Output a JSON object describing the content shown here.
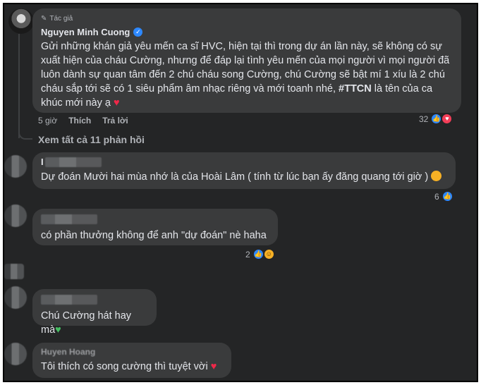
{
  "thread": {
    "author_badge": "Tác giả",
    "author_name": "Nguyen Minh Cuong",
    "body_before": "Gửi những khán giả yêu mến ca sĩ HVC, hiện tại thì trong dự án lần này, sẽ không có sự xuất hiện của cháu Cường, nhưng để đáp lại tình yêu mến của mọi người vì mọi người đã luôn dành sự quan tâm đến 2 chú cháu song Cường, chú Cường sẽ bật mí 1 xíu là 2 chú cháu sắp tới sẽ có 1 siêu phẩm âm nhạc riêng và mới toanh nhé, ",
    "hashtag": "#TTCN",
    "body_after": " là tên của ca khúc mới này ạ",
    "heart": "♥",
    "time": "5 giờ",
    "like_label": "Thích",
    "reply_label": "Trả lời",
    "reaction_count": "32",
    "view_replies": "Xem tất cả 11 phản hồi"
  },
  "replies": [
    {
      "name_visible": "I",
      "text": "Dự đoán Mười hai mùa nhớ là của Hoài Lâm ( tính từ lúc bạn ấy đăng quang tới giờ )",
      "reaction_count": "6"
    },
    {
      "text": "có phần thưởng không để anh \"dự đoán\" nè haha",
      "reaction_count": "2"
    },
    {
      "text": "Chú Cường hát hay mà",
      "emoji": "♥"
    },
    {
      "name_visible": "Huyen Hoang",
      "text": "Tôi thích có song cường thì tuyệt vời",
      "emoji": "♥"
    }
  ],
  "colors": {
    "background": "#242526",
    "bubble": "#3a3b3c",
    "text": "#e4e6eb",
    "muted": "#b0b3b8",
    "like_blue": "#2d88ff",
    "love_red": "#f33e58"
  }
}
